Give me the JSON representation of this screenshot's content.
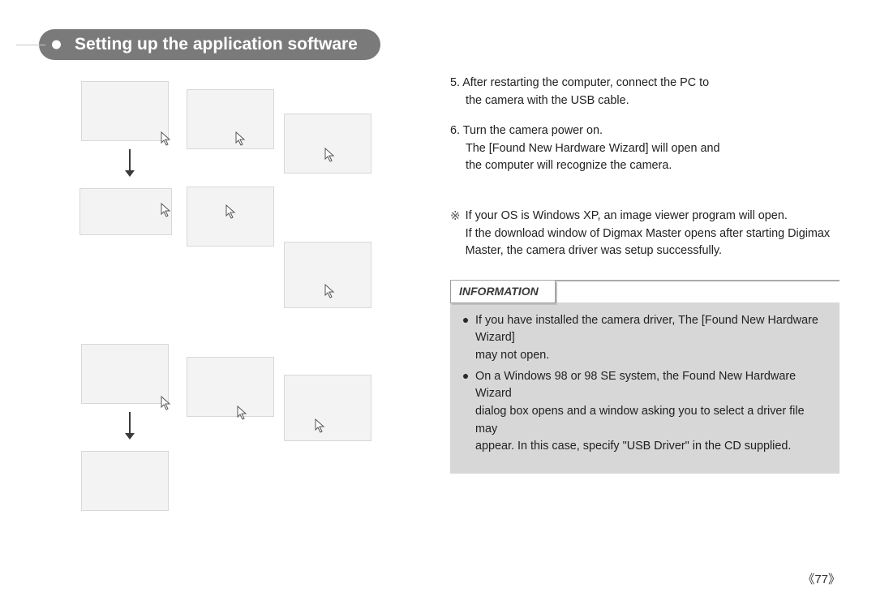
{
  "header": {
    "title": "Setting up the application software"
  },
  "steps": {
    "s5_line1": "5. After restarting the computer, connect the PC to",
    "s5_line2": "the camera with the USB cable.",
    "s6_line1": "6. Turn the camera power on.",
    "s6_line2": "The [Found New Hardware Wizard] will open and",
    "s6_line3": "the computer will recognize the camera."
  },
  "note": {
    "symbol": "※",
    "line1": "If your OS is Windows XP, an image viewer program will open.",
    "line2": "If the download window of Digmax Master opens after starting Digimax",
    "line3": "Master, the camera driver was setup successfully."
  },
  "info": {
    "label": "INFORMATION",
    "bullet1_line1": "If you have installed the camera driver, The [Found New Hardware Wizard]",
    "bullet1_line2": "may not open.",
    "bullet2_line1": "On a Windows 98 or 98 SE system, the Found New Hardware Wizard",
    "bullet2_line2": "dialog box opens and a window asking you to select a driver file may",
    "bullet2_line3": "appear. In this case, specify \"USB Driver\" in the CD supplied."
  },
  "page_number": "《77》"
}
